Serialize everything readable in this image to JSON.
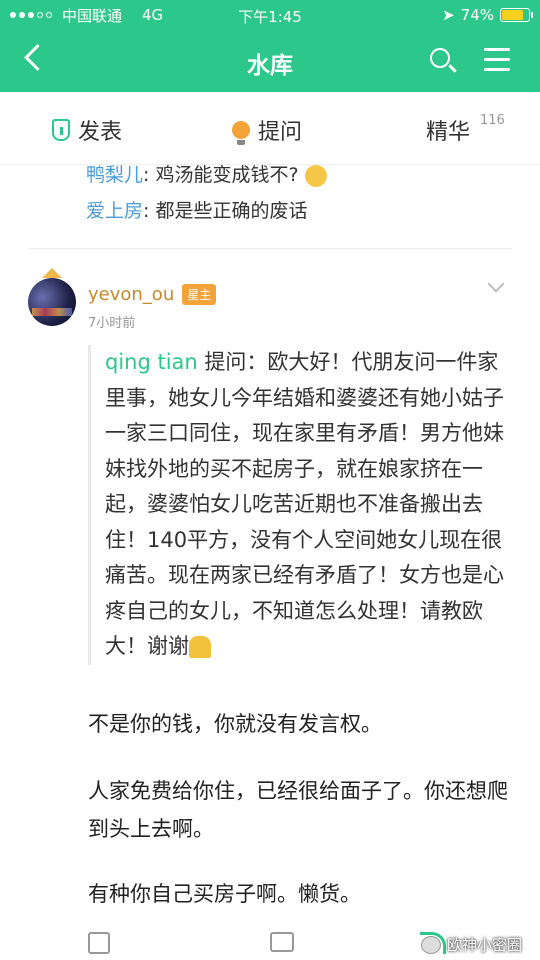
{
  "status_bar": {
    "carrier": "中国联通",
    "network": "4G",
    "time": "下午1:45",
    "battery": "74%",
    "battery_level": 0.74
  },
  "nav": {
    "title": "水库"
  },
  "tabs": {
    "publish": "发表",
    "ask": "提问",
    "essence": "精华",
    "essence_count": "116"
  },
  "previous_comments": [
    {
      "author": "鸭梨儿",
      "text": ": 鸡汤能变成钱不?"
    },
    {
      "author": "爱上房",
      "text": ": 都是些正确的废话"
    }
  ],
  "post": {
    "username": "yevon_ou",
    "badge": "星主",
    "time": "7小时前",
    "question_author": "qing tian",
    "question_text": " 提问：欧大好！代朋友问一件家里事，她女儿今年结婚和婆婆还有她小姑子一家三口同住，现在家里有矛盾！男方他妹妹找外地的买不起房子，就在娘家挤在一起，婆婆怕女儿吃苦近期也不准备搬出去住！140平方，没有个人空间她女儿现在很痛苦。现在两家已经有矛盾了！女方也是心疼自己的女儿，不知道怎么处理！请教欧大！谢谢",
    "answer_1": "不是你的钱，你就没有发言权。",
    "answer_2": "人家免费给你住，已经很给面子了。你还想爬到头上去啊。",
    "answer_3": "有种你自己买房子啊。懒货。"
  },
  "watermark": "欧神小密圈"
}
